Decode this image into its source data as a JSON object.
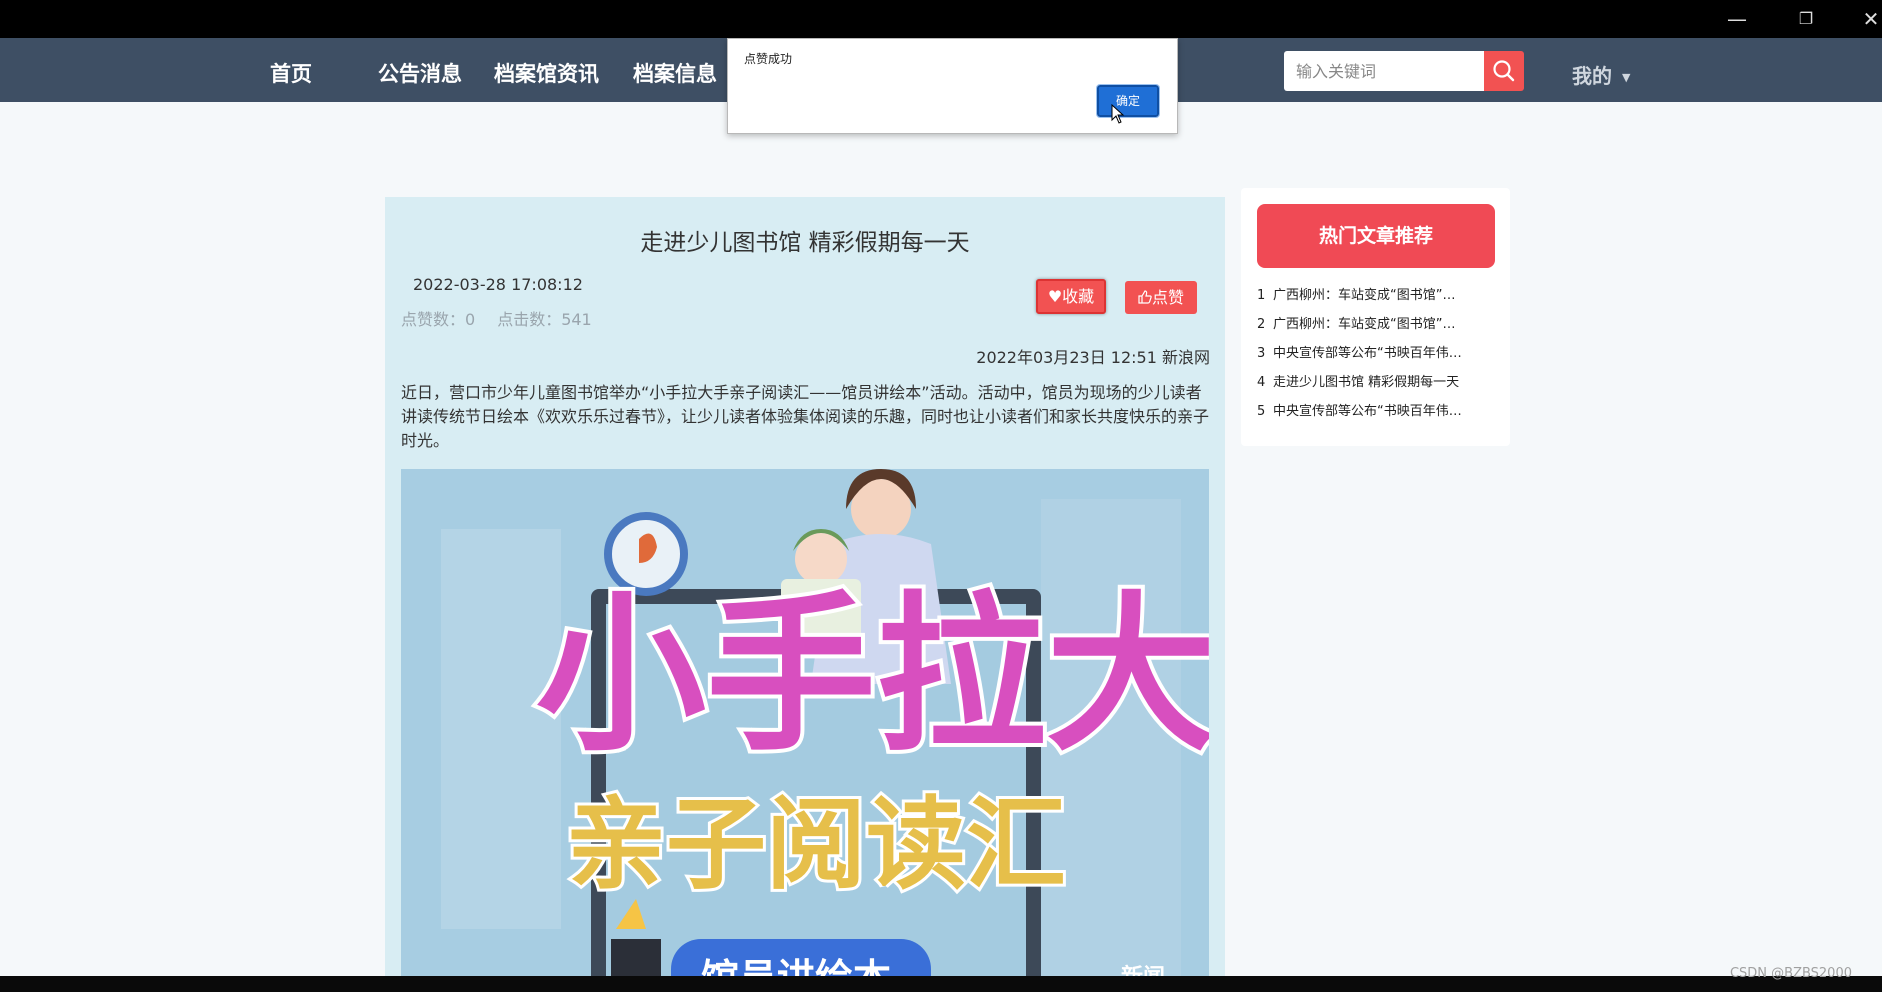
{
  "window": {
    "minimize": "—",
    "restore": "❐",
    "close": "✕"
  },
  "nav": {
    "items": [
      {
        "label": "首页"
      },
      {
        "label": "公告消息"
      },
      {
        "label": "档案馆资讯"
      },
      {
        "label": "档案信息"
      }
    ],
    "search": {
      "placeholder": "输入关键词",
      "icon": "search-icon"
    },
    "user_menu": "我的"
  },
  "dialog": {
    "message": "点赞成功",
    "ok_label": "确定"
  },
  "article": {
    "title": "走进少儿图书馆 精彩假期每一天",
    "datetime": "2022-03-28 17:08:12",
    "likes_text": "点赞数：0",
    "clicks_text": "点击数：541",
    "fav_label": "收藏",
    "like_label": "点赞",
    "source": "2022年03月23日 12:51 新浪网",
    "body": "近日，营口市少年儿童图书馆举办“小手拉大手亲子阅读汇——馆员讲绘本”活动。活动中，馆员为现场的少儿读者讲读传统节日绘本《欢欢乐乐过春节》，让少儿读者体验集体阅读的乐趣，同时也让小读者们和家长共度快乐的亲子时光。",
    "image": {
      "headline": "小手拉大手",
      "subline": "亲子阅读汇",
      "bottom": "馆员讲绘本",
      "badge": "新闻"
    }
  },
  "sidebar": {
    "title": "热门文章推荐",
    "items": [
      {
        "num": "1",
        "text": "广西柳州：车站变成“图书馆”…"
      },
      {
        "num": "2",
        "text": "广西柳州：车站变成“图书馆”…"
      },
      {
        "num": "3",
        "text": "中央宣传部等公布“书映百年伟…"
      },
      {
        "num": "4",
        "text": "走进少儿图书馆 精彩假期每一天"
      },
      {
        "num": "5",
        "text": "中央宣传部等公布“书映百年伟…"
      }
    ]
  },
  "watermark": "CSDN @BZBS2000"
}
